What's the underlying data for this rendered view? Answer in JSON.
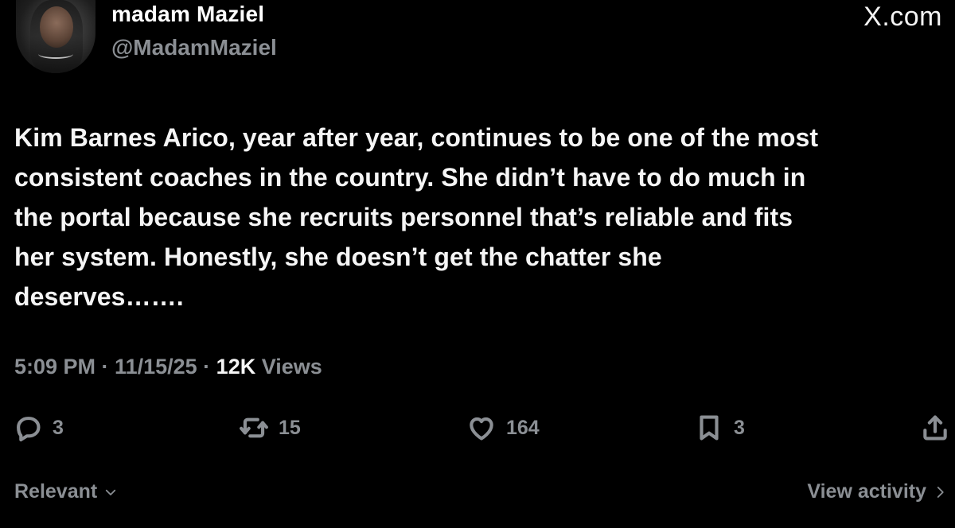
{
  "author": {
    "display_name": "madam Maziel",
    "handle": "@MadamMaziel"
  },
  "brand": "X.com",
  "tweet": {
    "lines": [
      "Kim Barnes Arico, year after year, continues to be one of the most",
      "consistent coaches in the country. She didn’t have to do much in",
      "the portal because she recruits personnel that’s reliable and fits",
      "her system. Honestly, she doesn’t get the chatter she",
      "deserves……."
    ]
  },
  "meta": {
    "time": "5:09 PM",
    "separator": " · ",
    "date": "11/15/25",
    "views_count": "12K",
    "views_label": " Views"
  },
  "actions": {
    "reply": {
      "icon": "reply-icon",
      "count": "3"
    },
    "repost": {
      "icon": "repost-icon",
      "count": "15"
    },
    "like": {
      "icon": "heart-icon",
      "count": "164"
    },
    "bookmark": {
      "icon": "bookmark-icon",
      "count": "3"
    },
    "share": {
      "icon": "share-icon"
    }
  },
  "footer": {
    "sort_label": "Relevant",
    "activity_label": "View activity"
  },
  "colors": {
    "background": "#000000",
    "primary_text": "#f5f5f5",
    "secondary_text": "#8b8f94"
  }
}
